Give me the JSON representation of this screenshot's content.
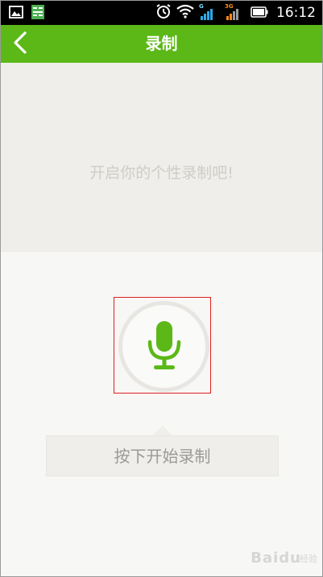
{
  "status_bar": {
    "time": "16:12",
    "net_tag_1": "G",
    "net_tag_2": "3G",
    "icons": [
      "gallery-icon",
      "app-notification-icon",
      "alarm-icon",
      "wifi-icon",
      "signal-icon",
      "signal-icon",
      "battery-icon"
    ]
  },
  "header": {
    "title": "录制",
    "back_icon": "chevron-left-icon"
  },
  "prompt": {
    "text": "开启你的个性录制吧!"
  },
  "record": {
    "mic_icon": "microphone-icon",
    "hint": "按下开始录制"
  },
  "colors": {
    "accent": "#5bb817",
    "highlight": "#e02020"
  },
  "watermark": {
    "text": "Baidu",
    "sub": "经验"
  }
}
